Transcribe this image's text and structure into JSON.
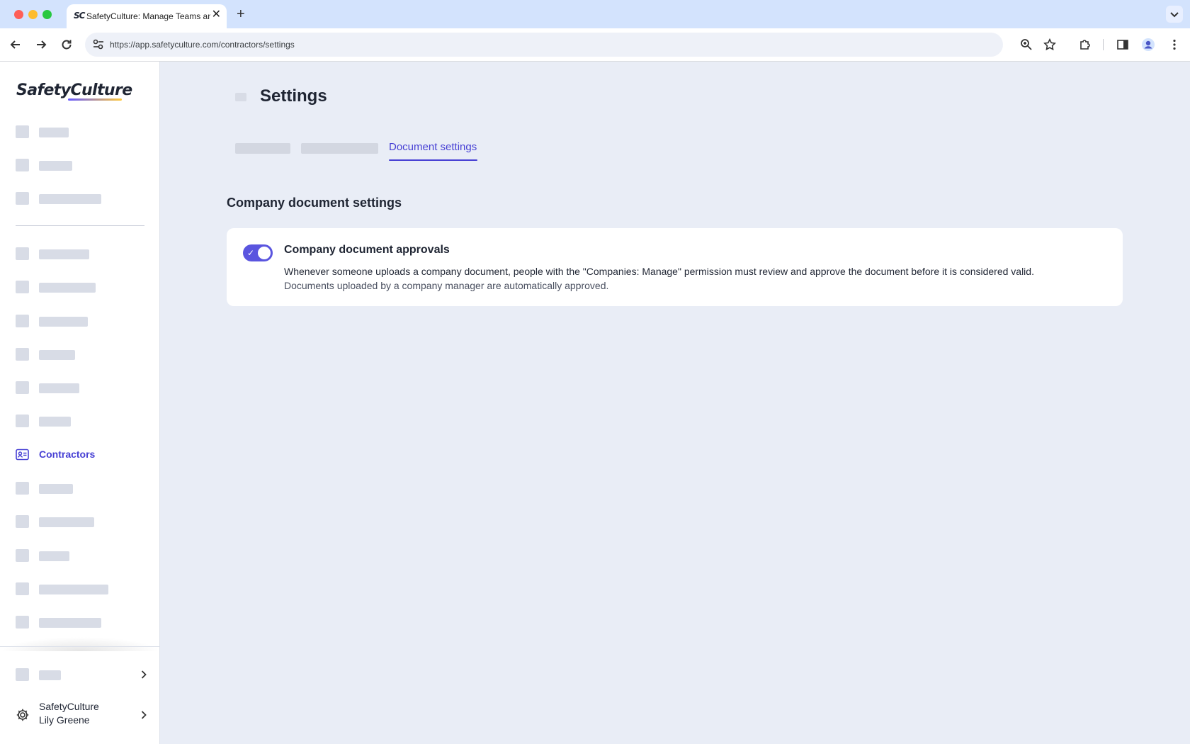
{
  "browser": {
    "tab_title": "SafetyCulture: Manage Teams and...",
    "tab_favicon": "SC",
    "url": "https://app.safetyculture.com/contractors/settings",
    "new_tab_symbol": "+",
    "close_symbol": "✕"
  },
  "sidebar": {
    "logo": "SafetyCulture",
    "active_item": {
      "label": "Contractors",
      "icon": "contractor-card-icon"
    },
    "account": {
      "org": "SafetyCulture",
      "user": "Lily Greene"
    }
  },
  "main": {
    "page_title": "Settings",
    "tabs": {
      "active_label": "Document settings"
    },
    "section_title": "Company document settings",
    "setting": {
      "title": "Company document approvals",
      "description_main": "Whenever someone uploads a company document, people with the \"Companies: Manage\" permission must review and approve the document before it is considered valid.",
      "description_note": "Documents uploaded by a company manager are automatically approved.",
      "enabled": true
    }
  },
  "colors": {
    "accent": "#4740d4",
    "toggle_on": "#5a55df",
    "page_bg": "#e9edf6",
    "placeholder": "#d8dce6"
  }
}
